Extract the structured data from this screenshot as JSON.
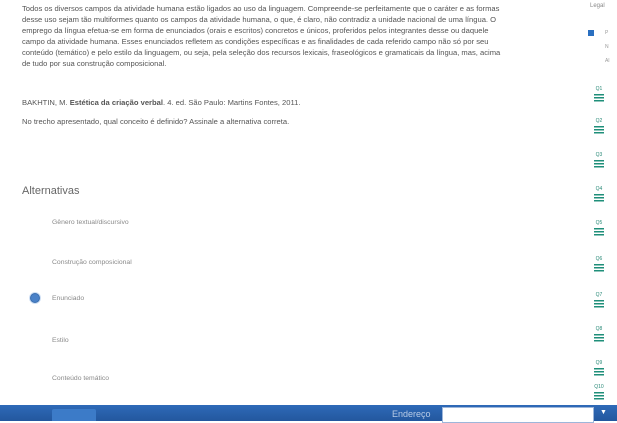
{
  "passage": {
    "lines": [
      "Todos os diversos campos da atividade humana estão ligados ao uso da linguagem. Compreende-se perfeitamente que o caráter e as formas",
      "desse uso sejam tão multiformes quanto os campos da atividade humana, o que, é claro, não contradiz a unidade nacional de uma língua. O",
      "emprego da língua efetua-se em forma de enunciados (orais e escritos) concretos e únicos, proferidos pelos integrantes desse ou daquele",
      "campo da atividade humana. Esses enunciados refletem as condições específicas e as finalidades de cada referido campo não só por seu",
      "conteúdo (temático) e pelo estilo da linguagem, ou seja, pela seleção dos recursos lexicais, fraseológicos e gramaticais da língua, mas, acima",
      "de tudo por sua construção composicional."
    ]
  },
  "citation": {
    "before": "BAKHTIN, M. ",
    "bold": "Estética da criação verbal",
    "after": ". 4. ed. São Paulo: Martins Fontes, 2011."
  },
  "question": "No trecho apresentado, qual conceito é definido? Assinale a alternativa correta.",
  "alternatives": {
    "title": "Alternativas",
    "options": [
      {
        "label": "Gênero textual/discursivo",
        "selected": false
      },
      {
        "label": "Construção composicional",
        "selected": false
      },
      {
        "label": "Enunciado",
        "selected": true
      },
      {
        "label": "Estilo",
        "selected": false
      },
      {
        "label": "Conteúdo temático",
        "selected": false
      }
    ]
  },
  "sidebar": {
    "header": "Legal",
    "flag_text": "N",
    "extra": [
      "P",
      "Al"
    ],
    "questions": [
      "Q1",
      "Q2",
      "Q3",
      "Q4",
      "Q5",
      "Q6",
      "Q7",
      "Q8",
      "Q9",
      "Q10"
    ]
  },
  "bottombar": {
    "field_label": "Endereço"
  },
  "colors": {
    "accent": "#2e6ab8",
    "sidebar_icon": "#1f8f7a",
    "radio_selected": "#4a82c8"
  }
}
